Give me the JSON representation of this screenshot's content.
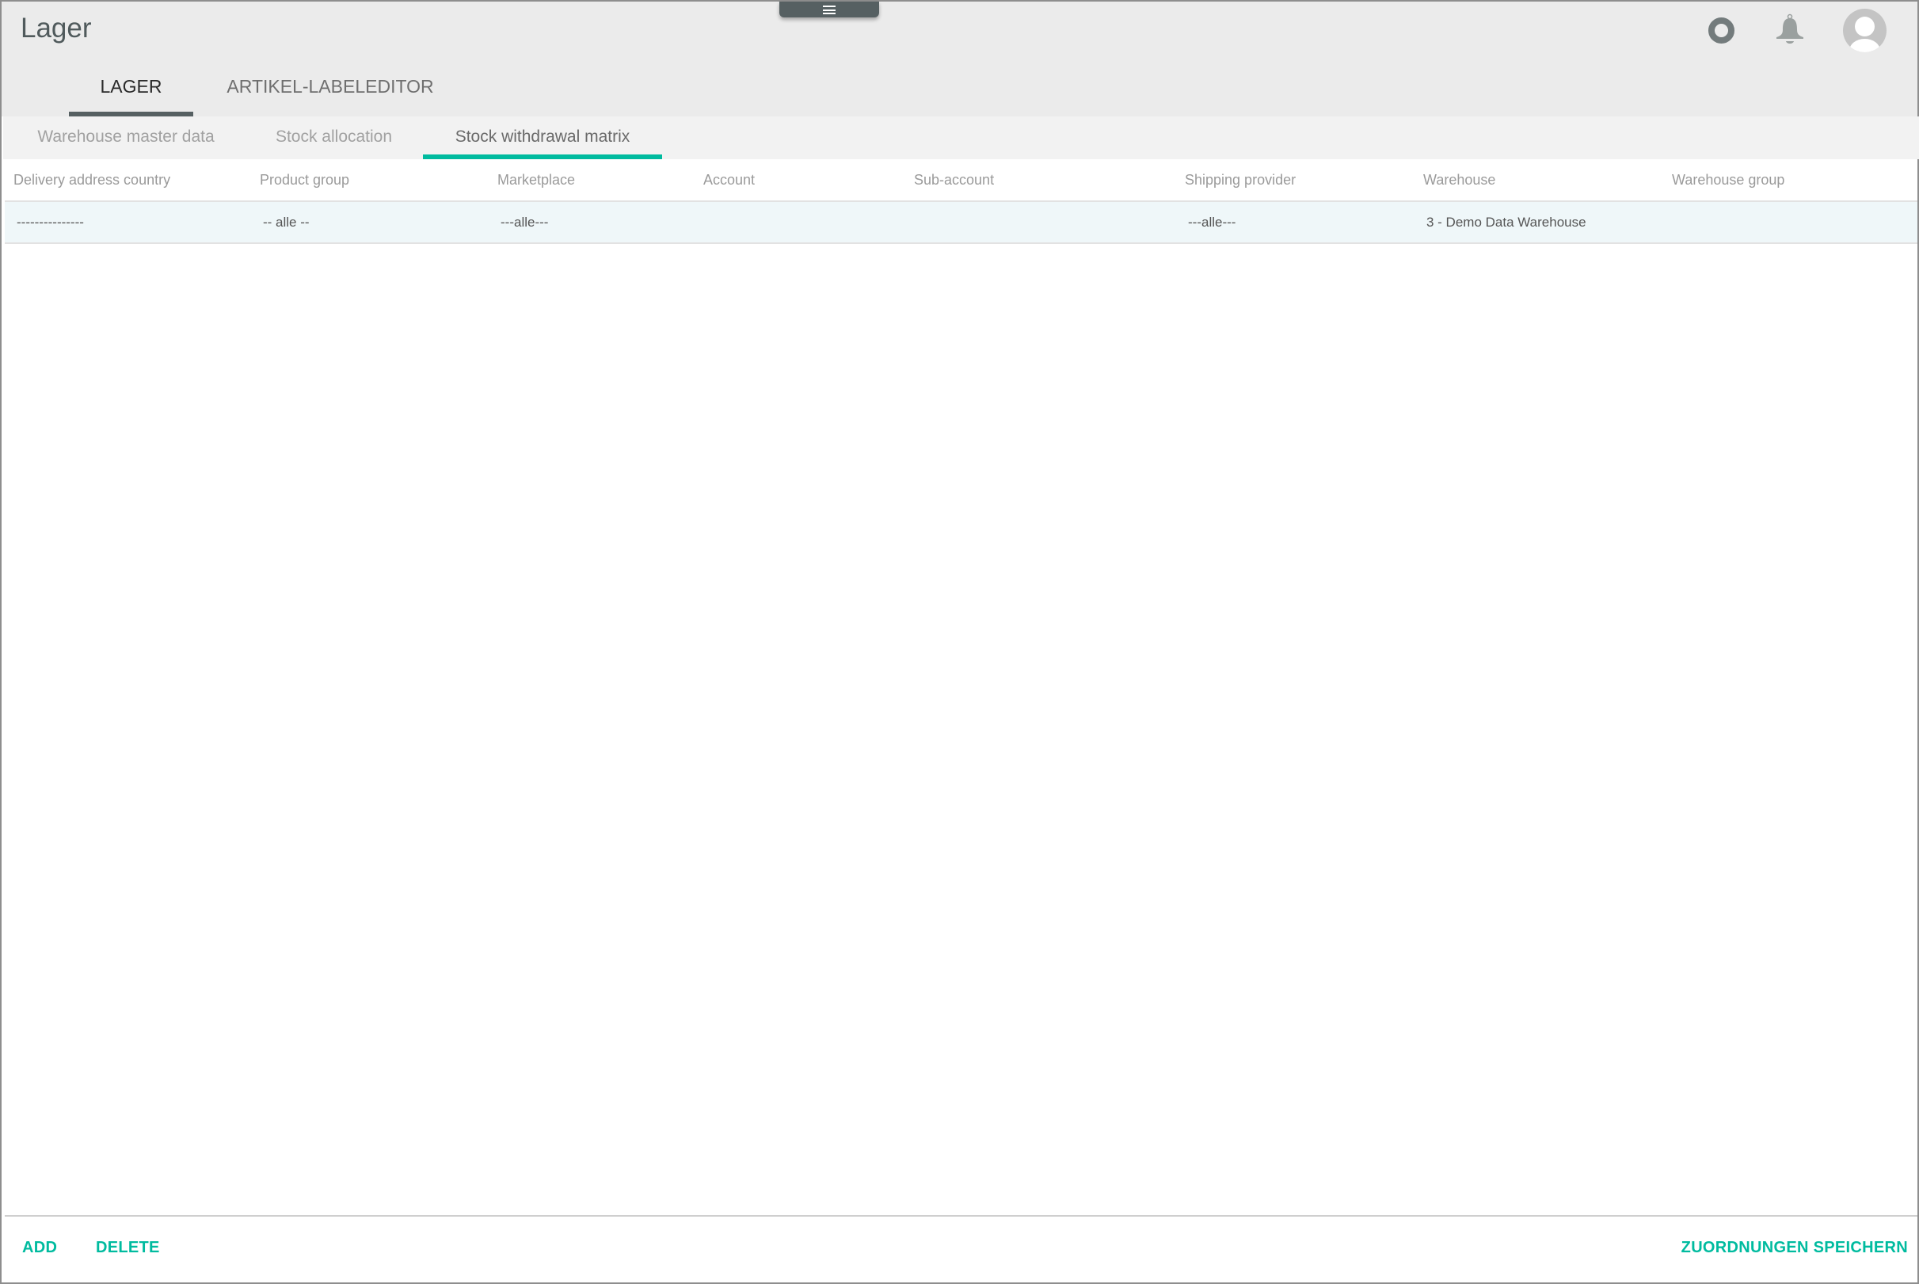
{
  "app": {
    "title": "Lager"
  },
  "header_icons": {
    "status": "circle-status-icon",
    "notifications": "bell-icon",
    "user": "avatar-icon"
  },
  "main_tabs": [
    {
      "label": "LAGER",
      "active": true
    },
    {
      "label": "ARTIKEL-LABELEDITOR",
      "active": false
    }
  ],
  "sub_tabs": [
    {
      "label": "Warehouse master data",
      "active": false
    },
    {
      "label": "Stock allocation",
      "active": false
    },
    {
      "label": "Stock withdrawal matrix",
      "active": true
    }
  ],
  "grid": {
    "columns": [
      "Delivery address country",
      "Product group",
      "Marketplace",
      "Account",
      "Sub-account",
      "Shipping provider",
      "Warehouse",
      "Warehouse group"
    ],
    "rows": [
      [
        "---------------",
        "-- alle --",
        "---alle---",
        "",
        "",
        "---alle---",
        "3 - Demo Data Warehouse",
        ""
      ]
    ]
  },
  "footer": {
    "add_label": "ADD",
    "delete_label": "DELETE",
    "save_label": "ZUORDNUNGEN SPEICHERN"
  },
  "colors": {
    "accent": "#00bb9f",
    "tab_indicator": "#566062",
    "selected_row": "#eff7f9"
  }
}
